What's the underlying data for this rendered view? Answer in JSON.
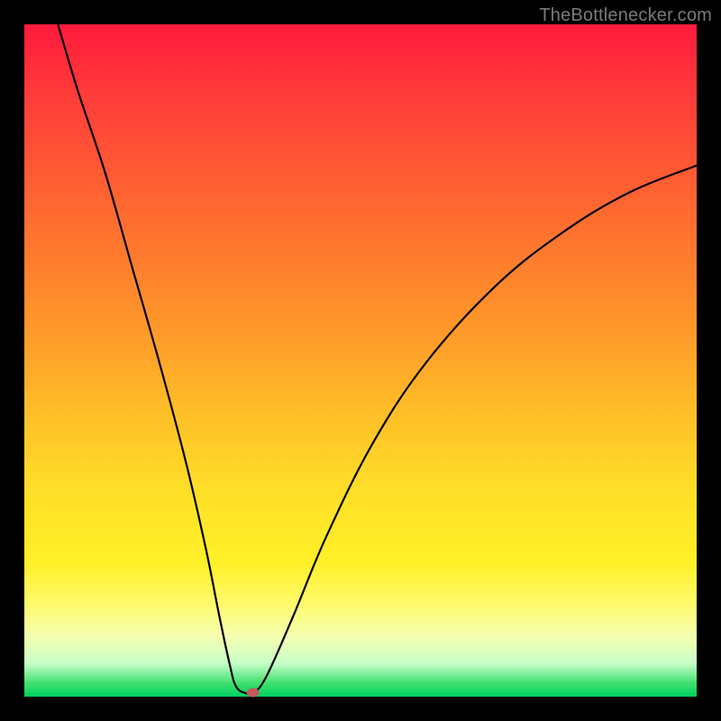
{
  "watermark": {
    "text": "TheBottlenecker.com"
  },
  "chart_data": {
    "type": "line",
    "title": "",
    "xlabel": "",
    "ylabel": "",
    "xlim": [
      0,
      100
    ],
    "ylim": [
      0,
      100
    ],
    "gradient_top_color": "#ff1a3c",
    "gradient_bottom_color": "#00d060",
    "curve_points": [
      {
        "x": 5,
        "y": 100
      },
      {
        "x": 8,
        "y": 90
      },
      {
        "x": 12,
        "y": 78
      },
      {
        "x": 16,
        "y": 64
      },
      {
        "x": 20,
        "y": 50
      },
      {
        "x": 24,
        "y": 35
      },
      {
        "x": 27,
        "y": 22
      },
      {
        "x": 29,
        "y": 12
      },
      {
        "x": 30.5,
        "y": 5
      },
      {
        "x": 31.5,
        "y": 1.5
      },
      {
        "x": 33,
        "y": 0.5
      },
      {
        "x": 34,
        "y": 0.5
      },
      {
        "x": 36,
        "y": 3
      },
      {
        "x": 40,
        "y": 12
      },
      {
        "x": 45,
        "y": 24
      },
      {
        "x": 52,
        "y": 38
      },
      {
        "x": 60,
        "y": 50
      },
      {
        "x": 70,
        "y": 61
      },
      {
        "x": 80,
        "y": 69
      },
      {
        "x": 90,
        "y": 75
      },
      {
        "x": 100,
        "y": 79
      }
    ],
    "marker": {
      "x": 34,
      "y": 0.6
    },
    "notes": "V-shaped bottleneck curve on rainbow gradient; minimum near x≈33, curve rises asymptotically toward upper right."
  }
}
